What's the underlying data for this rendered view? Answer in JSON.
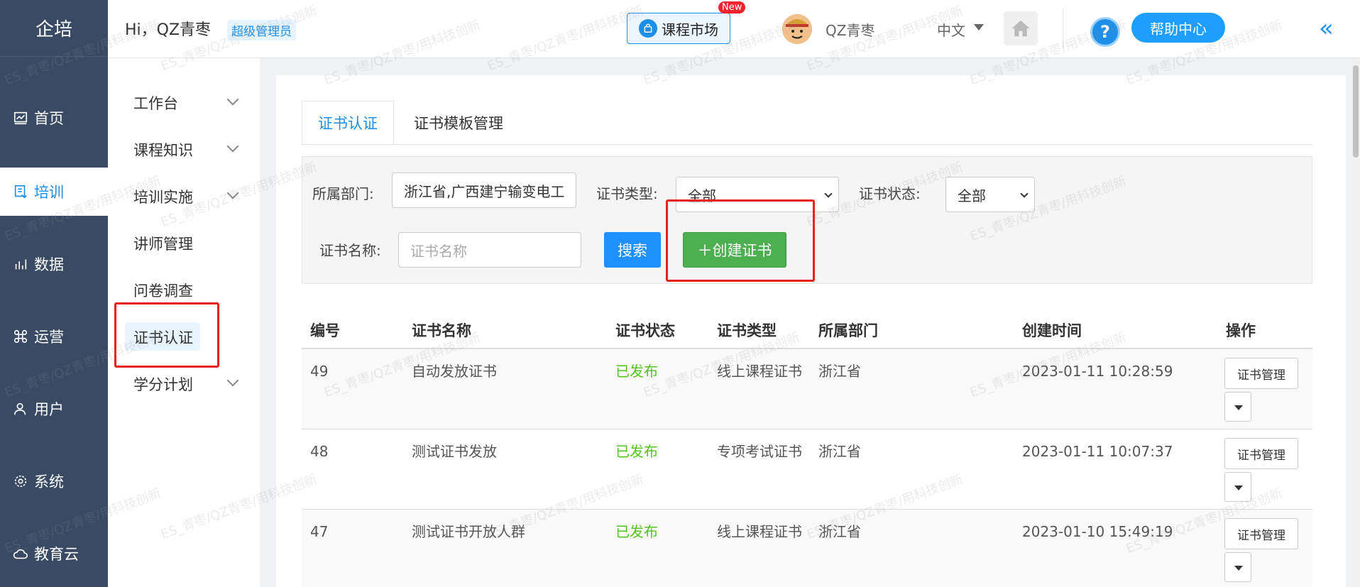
{
  "app": {
    "logo": "企培"
  },
  "header": {
    "greeting": "Hi，QZ青枣",
    "role": "超级管理员",
    "market_label": "课程市场",
    "new_badge": "New",
    "username": "QZ青枣",
    "language": "中文",
    "help_label": "帮助中心",
    "help_q": "?",
    "collapse": "«"
  },
  "sidebar": {
    "items": [
      {
        "label": "首页",
        "icon": "chart-icon"
      },
      {
        "label": "培训",
        "icon": "book-icon",
        "active": true
      },
      {
        "label": "数据",
        "icon": "bar-chart-icon"
      },
      {
        "label": "运营",
        "icon": "command-icon"
      },
      {
        "label": "用户",
        "icon": "user-icon"
      },
      {
        "label": "系统",
        "icon": "gear-icon"
      },
      {
        "label": "教育云",
        "icon": "cloud-icon"
      }
    ]
  },
  "submenu": {
    "items": [
      {
        "label": "工作台"
      },
      {
        "label": "课程知识"
      },
      {
        "label": "培训实施"
      },
      {
        "label": "讲师管理"
      },
      {
        "label": "问卷调查"
      },
      {
        "label": "证书认证"
      },
      {
        "label": "学分计划"
      }
    ]
  },
  "tabs": [
    {
      "label": "证书认证"
    },
    {
      "label": "证书模板管理"
    }
  ],
  "filters": {
    "dept_label": "所属部门:",
    "dept_value": "浙江省,广西建宁输变电工",
    "type_label": "证书类型:",
    "type_value": "全部",
    "status_label": "证书状态:",
    "status_value": "全部",
    "name_label": "证书名称:",
    "name_placeholder": "证书名称",
    "search_label": "搜索",
    "create_label": "＋创建证书"
  },
  "table": {
    "headers": [
      "编号",
      "证书名称",
      "证书状态",
      "证书类型",
      "所属部门",
      "创建时间",
      "操作"
    ],
    "rows": [
      {
        "id": "49",
        "name": "自动发放证书",
        "status": "已发布",
        "type": "线上课程证书",
        "dept": "浙江省",
        "created": "2023-01-11 10:28:59",
        "action": "证书管理"
      },
      {
        "id": "48",
        "name": "测试证书发放",
        "status": "已发布",
        "type": "专项考试证书",
        "dept": "浙江省",
        "created": "2023-01-11 10:07:37",
        "action": "证书管理"
      },
      {
        "id": "47",
        "name": "测试证书开放人群",
        "status": "已发布",
        "type": "线上课程证书",
        "dept": "浙江省",
        "created": "2023-01-10 15:49:19",
        "action": "证书管理"
      }
    ]
  },
  "watermark": "ES_青枣/QZ青枣/用科技创新",
  "colors": {
    "sidebar": "#3b4a64",
    "accent": "#1e8fe8",
    "success": "#52c41a",
    "create": "#4caf50",
    "highlight": "#e8221a"
  }
}
